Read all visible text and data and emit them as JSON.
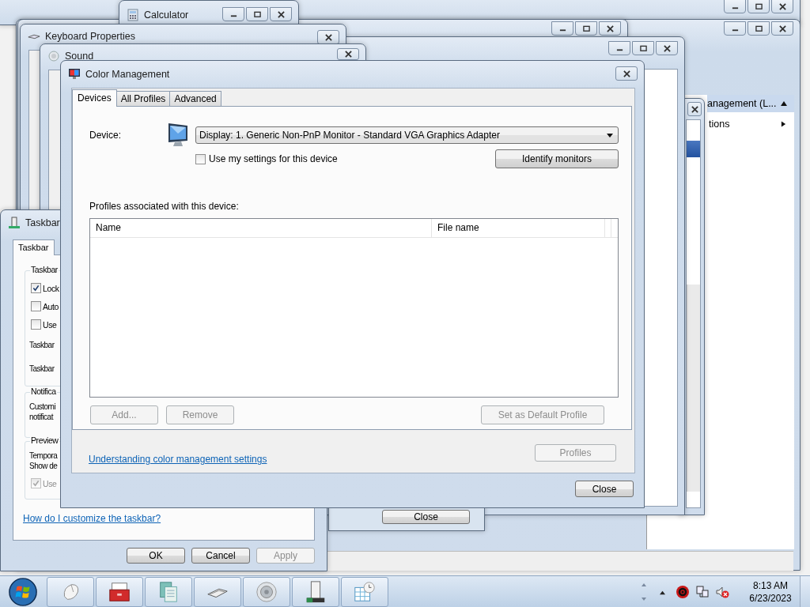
{
  "background_window": {
    "panel_header": "anagement (L...",
    "panel_item": "tions"
  },
  "calculator": {
    "title": "Calculator"
  },
  "keyboard_properties": {
    "title": "Keyboard Properties"
  },
  "sound": {
    "title": "Sound"
  },
  "hidden_dialog": {
    "button": "Close"
  },
  "taskbar_properties": {
    "title": "Taskbar",
    "tabs": [
      {
        "label": "Taskbar",
        "selected": true
      }
    ],
    "groups": [
      {
        "legend": "Taskbar",
        "items": [
          {
            "kind": "checkbox",
            "label": "Lock",
            "checked": true,
            "disabled": false
          },
          {
            "kind": "checkbox",
            "label": "Auto",
            "checked": false,
            "disabled": false
          },
          {
            "kind": "checkbox",
            "label": "Use",
            "checked": false,
            "disabled": false
          },
          {
            "kind": "text",
            "label": "Taskbar"
          },
          {
            "kind": "text",
            "label": "Taskbar"
          }
        ]
      },
      {
        "legend": "Notifica",
        "items": [
          {
            "kind": "line",
            "label": "Customi"
          },
          {
            "kind": "line",
            "label": "notificat"
          }
        ]
      },
      {
        "legend": "Preview",
        "items": [
          {
            "kind": "line",
            "label": "Tempora"
          },
          {
            "kind": "line",
            "label": "Show de"
          },
          {
            "kind": "checkbox",
            "label": "Use",
            "checked": true,
            "disabled": true
          }
        ]
      }
    ],
    "help_link": "How do I customize the taskbar?",
    "buttons": [
      {
        "label": "OK",
        "disabled": false
      },
      {
        "label": "Cancel",
        "disabled": false
      },
      {
        "label": "Apply",
        "disabled": true
      }
    ]
  },
  "color_management": {
    "title": "Color Management",
    "tabs": [
      {
        "label": "Devices",
        "selected": true
      },
      {
        "label": "All Profiles",
        "selected": false
      },
      {
        "label": "Advanced",
        "selected": false
      }
    ],
    "device_label": "Device:",
    "device_value": "Display: 1. Generic Non-PnP Monitor - Standard VGA Graphics Adapter",
    "use_my_settings": {
      "label": "Use my settings for this device",
      "checked": false
    },
    "identify_button": "Identify monitors",
    "profiles_label": "Profiles associated with this device:",
    "columns": [
      "Name",
      "File name"
    ],
    "list_buttons": [
      {
        "label": "Add...",
        "disabled": true
      },
      {
        "label": "Remove",
        "disabled": true
      },
      {
        "label": "Set as Default Profile",
        "disabled": true
      }
    ],
    "help_link": "Understanding color management settings",
    "profiles_button": {
      "label": "Profiles",
      "disabled": true
    },
    "close_button": "Close"
  },
  "taskbar": {
    "time": "8:13 AM",
    "date": "6/23/2023"
  }
}
